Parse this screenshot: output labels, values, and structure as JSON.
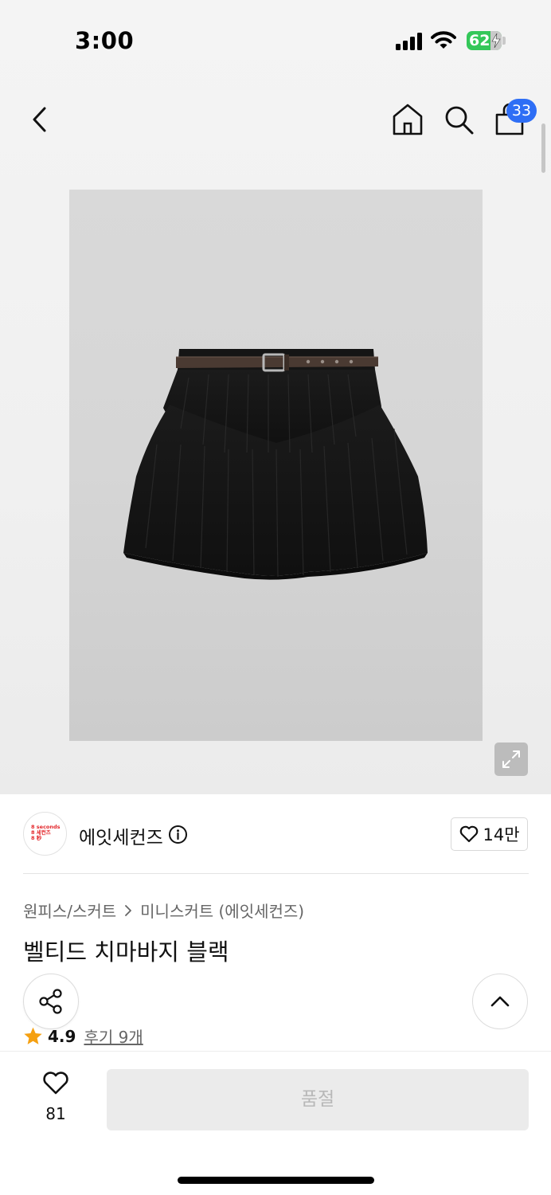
{
  "status_bar": {
    "time": "3:00",
    "battery": "62"
  },
  "nav": {
    "back_icon": "chevron-left-icon",
    "home_icon": "home-icon",
    "search_icon": "search-icon",
    "bag_icon": "shopping-bag-icon",
    "bag_badge": "33"
  },
  "product": {
    "image_desc_icon": "black-skirt-image",
    "expand_icon": "expand-icon",
    "brand": {
      "logo_lines": [
        "8 seconds",
        "8 세컨즈",
        "8 秒"
      ],
      "name": "에잇세컨즈",
      "likes": "14만"
    },
    "breadcrumb": [
      "원피스/스커트",
      "미니스커트 (에잇세컨즈)"
    ],
    "title": "벨티드 치마바지 블랙",
    "rating": {
      "score": "4.9",
      "reviews": "후기 9개"
    }
  },
  "bottom_bar": {
    "wish_count": "81",
    "cta_label": "품절"
  },
  "colors": {
    "accent_blue": "#2e6ef5",
    "battery_green": "#34c759",
    "star_orange": "#f5a011",
    "brand_red": "#e3262a"
  }
}
